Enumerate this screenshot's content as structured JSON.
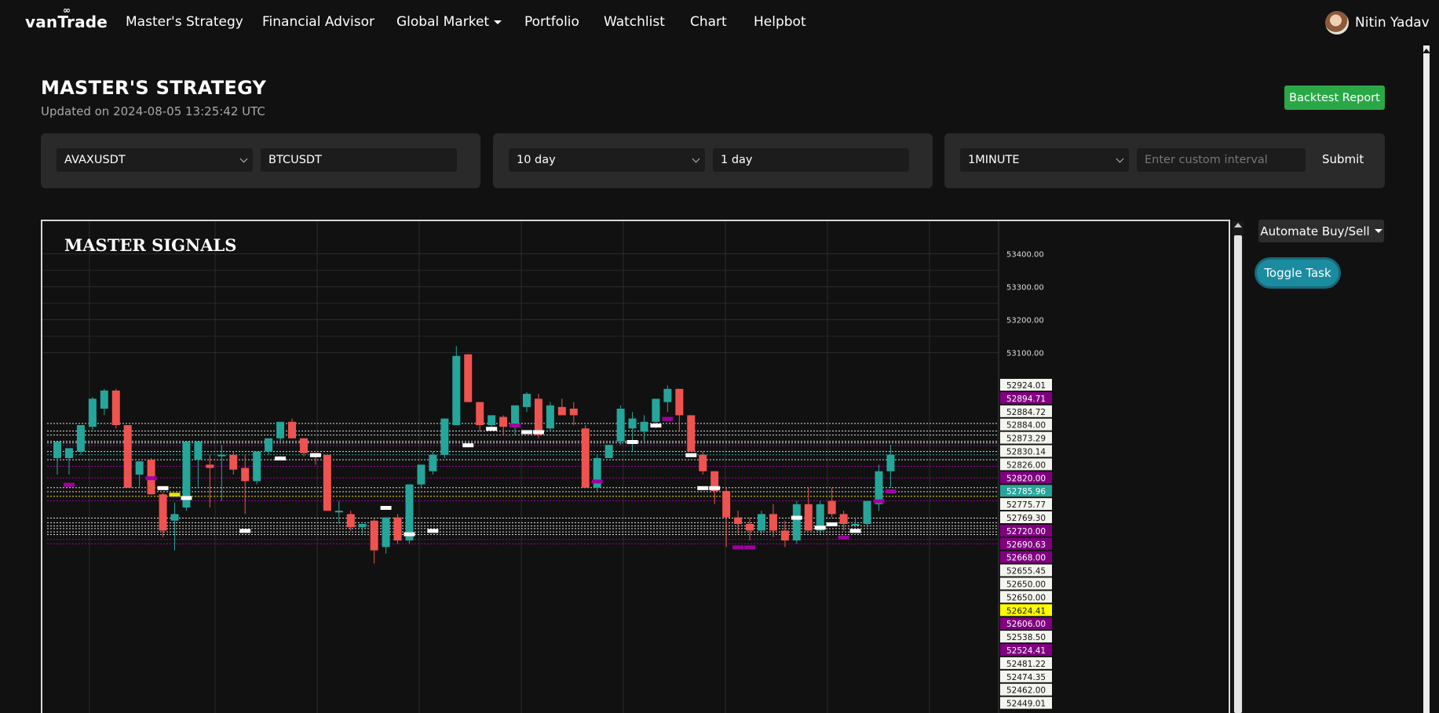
{
  "brand": {
    "logo_text": "vanTrade",
    "logo_mark": "∞"
  },
  "nav": {
    "items": [
      {
        "label": "Master's Strategy"
      },
      {
        "label": "Financial Advisor"
      },
      {
        "label": "Global Market"
      },
      {
        "label": "Portfolio"
      },
      {
        "label": "Watchlist"
      },
      {
        "label": "Chart"
      },
      {
        "label": "Helpbot"
      }
    ],
    "user_name": "Nitin Yadav"
  },
  "page": {
    "title": "MASTER'S STRATEGY",
    "updated": "Updated on 2024-08-05 13:25:42 UTC",
    "backtest_label": "Backtest Report"
  },
  "filters": {
    "symbol_select": "AVAXUSDT",
    "symbol_input": "BTCUSDT",
    "range_select": "10 day",
    "range_input": "1 day",
    "interval_select": "1MINUTE",
    "interval_placeholder": "Enter custom interval",
    "submit_label": "Submit"
  },
  "side": {
    "automate_label": "Automate Buy/Sell",
    "toggle_label": "Toggle Task"
  },
  "colors": {
    "up": "#26a69a",
    "down": "#ef5350",
    "purple": "#800080",
    "yellow": "#ffff00",
    "accent_green": "#2aa847",
    "toggle": "#1b8ca0"
  },
  "chart_data": {
    "type": "candlestick",
    "title": "MASTER SIGNALS",
    "ylim": [
      52440,
      53480
    ],
    "axis_ticks": [
      53400,
      53300,
      53200,
      53100
    ],
    "price_labels": [
      {
        "text": "52924.01",
        "value": 52924.01,
        "style": "white"
      },
      {
        "text": "52894.71",
        "value": 52894.71,
        "style": "purple"
      },
      {
        "text": "52884.72",
        "value": 52884.72,
        "style": "white"
      },
      {
        "text": "52884.00",
        "value": 52884.0,
        "style": "white"
      },
      {
        "text": "52873.29",
        "value": 52873.29,
        "style": "white"
      },
      {
        "text": "52830.14",
        "value": 52830.14,
        "style": "white"
      },
      {
        "text": "52826.00",
        "value": 52826.0,
        "style": "white"
      },
      {
        "text": "52820.00",
        "value": 52820.0,
        "style": "purple"
      },
      {
        "text": "52785.96",
        "value": 52785.96,
        "style": "teal"
      },
      {
        "text": "52775.77",
        "value": 52775.77,
        "style": "white"
      },
      {
        "text": "52769.30",
        "value": 52769.3,
        "style": "white"
      },
      {
        "text": "52720.00",
        "value": 52720.0,
        "style": "purple"
      },
      {
        "text": "52690.63",
        "value": 52690.63,
        "style": "purple"
      },
      {
        "text": "52668.00",
        "value": 52668.0,
        "style": "purple"
      },
      {
        "text": "52655.45",
        "value": 52655.45,
        "style": "white"
      },
      {
        "text": "52650.00",
        "value": 52650.0,
        "style": "white"
      },
      {
        "text": "52650.00",
        "value": 52650.0,
        "style": "white"
      },
      {
        "text": "52624.41",
        "value": 52624.41,
        "style": "yellow"
      },
      {
        "text": "52606.00",
        "value": 52606.0,
        "style": "purple"
      },
      {
        "text": "52538.50",
        "value": 52538.5,
        "style": "white"
      },
      {
        "text": "52524.41",
        "value": 52524.41,
        "style": "purple"
      },
      {
        "text": "52481.22",
        "value": 52481.22,
        "style": "white"
      },
      {
        "text": "52474.35",
        "value": 52474.35,
        "style": "white"
      },
      {
        "text": "52462.00",
        "value": 52462.0,
        "style": "white"
      },
      {
        "text": "52449.01",
        "value": 52449.01,
        "style": "white"
      }
    ],
    "level_lines": [
      {
        "value": 52885,
        "style": "white"
      },
      {
        "value": 52862,
        "style": "white"
      },
      {
        "value": 52850,
        "style": "white"
      },
      {
        "value": 52831,
        "style": "white"
      },
      {
        "value": 52826,
        "style": "white"
      },
      {
        "value": 52818,
        "style": "purple"
      },
      {
        "value": 52800,
        "style": "white"
      },
      {
        "value": 52790,
        "style": "teal"
      },
      {
        "value": 52775,
        "style": "white"
      },
      {
        "value": 52755,
        "style": "purple"
      },
      {
        "value": 52720,
        "style": "purple"
      },
      {
        "value": 52690,
        "style": "white"
      },
      {
        "value": 52678,
        "style": "white"
      },
      {
        "value": 52664,
        "style": "yellow"
      },
      {
        "value": 52650,
        "style": "purple"
      },
      {
        "value": 52598,
        "style": "white"
      },
      {
        "value": 52584,
        "style": "white"
      },
      {
        "value": 52574,
        "style": "white"
      },
      {
        "value": 52566,
        "style": "white"
      },
      {
        "value": 52556,
        "style": "white"
      },
      {
        "value": 52548,
        "style": "white"
      },
      {
        "value": 52533,
        "style": "purple"
      },
      {
        "value": 52520,
        "style": "purple"
      }
    ],
    "candles": [
      {
        "o": 52780,
        "h": 52830,
        "l": 52730,
        "c": 52830
      },
      {
        "o": 52780,
        "h": 52805,
        "l": 52730,
        "c": 52810
      },
      {
        "o": 52800,
        "h": 52880,
        "l": 52790,
        "c": 52880
      },
      {
        "o": 52875,
        "h": 52965,
        "l": 52865,
        "c": 52960
      },
      {
        "o": 52930,
        "h": 52990,
        "l": 52910,
        "c": 52985
      },
      {
        "o": 52985,
        "h": 52990,
        "l": 52870,
        "c": 52880
      },
      {
        "o": 52880,
        "h": 52880,
        "l": 52690,
        "c": 52690
      },
      {
        "o": 52730,
        "h": 52770,
        "l": 52690,
        "c": 52770
      },
      {
        "o": 52775,
        "h": 52780,
        "l": 52670,
        "c": 52670
      },
      {
        "o": 52670,
        "h": 52675,
        "l": 52540,
        "c": 52560
      },
      {
        "o": 52590,
        "h": 52645,
        "l": 52500,
        "c": 52610
      },
      {
        "o": 52630,
        "h": 52820,
        "l": 52620,
        "c": 52830
      },
      {
        "o": 52775,
        "h": 52830,
        "l": 52690,
        "c": 52830
      },
      {
        "o": 52760,
        "h": 52790,
        "l": 52630,
        "c": 52750
      },
      {
        "o": 52790,
        "h": 52820,
        "l": 52650,
        "c": 52790
      },
      {
        "o": 52790,
        "h": 52800,
        "l": 52730,
        "c": 52745
      },
      {
        "o": 52750,
        "h": 52790,
        "l": 52610,
        "c": 52710
      },
      {
        "o": 52710,
        "h": 52800,
        "l": 52700,
        "c": 52800
      },
      {
        "o": 52800,
        "h": 52840,
        "l": 52790,
        "c": 52840
      },
      {
        "o": 52840,
        "h": 52890,
        "l": 52830,
        "c": 52890
      },
      {
        "o": 52890,
        "h": 52900,
        "l": 52840,
        "c": 52840
      },
      {
        "o": 52840,
        "h": 52840,
        "l": 52785,
        "c": 52795
      },
      {
        "o": 52795,
        "h": 52790,
        "l": 52760,
        "c": 52790
      },
      {
        "o": 52790,
        "h": 52790,
        "l": 52620,
        "c": 52620
      },
      {
        "o": 52620,
        "h": 52650,
        "l": 52580,
        "c": 52620
      },
      {
        "o": 52610,
        "h": 52620,
        "l": 52560,
        "c": 52570
      },
      {
        "o": 52570,
        "h": 52580,
        "l": 52550,
        "c": 52580
      },
      {
        "o": 52590,
        "h": 52595,
        "l": 52460,
        "c": 52500
      },
      {
        "o": 52510,
        "h": 52600,
        "l": 52490,
        "c": 52600
      },
      {
        "o": 52600,
        "h": 52610,
        "l": 52520,
        "c": 52530
      },
      {
        "o": 52530,
        "h": 52700,
        "l": 52520,
        "c": 52700
      },
      {
        "o": 52700,
        "h": 52760,
        "l": 52690,
        "c": 52760
      },
      {
        "o": 52740,
        "h": 52800,
        "l": 52730,
        "c": 52790
      },
      {
        "o": 52790,
        "h": 52900,
        "l": 52780,
        "c": 52900
      },
      {
        "o": 52880,
        "h": 53120,
        "l": 52880,
        "c": 53090
      },
      {
        "o": 53095,
        "h": 53095,
        "l": 52950,
        "c": 52950
      },
      {
        "o": 52950,
        "h": 52950,
        "l": 52860,
        "c": 52880
      },
      {
        "o": 52880,
        "h": 52910,
        "l": 52870,
        "c": 52910
      },
      {
        "o": 52905,
        "h": 52910,
        "l": 52850,
        "c": 52875
      },
      {
        "o": 52880,
        "h": 52940,
        "l": 52850,
        "c": 52940
      },
      {
        "o": 52935,
        "h": 52980,
        "l": 52920,
        "c": 52975
      },
      {
        "o": 52960,
        "h": 52975,
        "l": 52840,
        "c": 52850
      },
      {
        "o": 52870,
        "h": 52950,
        "l": 52860,
        "c": 52940
      },
      {
        "o": 52935,
        "h": 52960,
        "l": 52915,
        "c": 52910
      },
      {
        "o": 52930,
        "h": 52950,
        "l": 52880,
        "c": 52910
      },
      {
        "o": 52870,
        "h": 52880,
        "l": 52700,
        "c": 52690
      },
      {
        "o": 52690,
        "h": 52790,
        "l": 52680,
        "c": 52780
      },
      {
        "o": 52780,
        "h": 52820,
        "l": 52780,
        "c": 52820
      },
      {
        "o": 52830,
        "h": 52940,
        "l": 52820,
        "c": 52930
      },
      {
        "o": 52870,
        "h": 52920,
        "l": 52800,
        "c": 52900
      },
      {
        "o": 52860,
        "h": 52910,
        "l": 52830,
        "c": 52890
      },
      {
        "o": 52890,
        "h": 52950,
        "l": 52870,
        "c": 52960
      },
      {
        "o": 52950,
        "h": 53000,
        "l": 52920,
        "c": 52990
      },
      {
        "o": 52990,
        "h": 52990,
        "l": 52860,
        "c": 52910
      },
      {
        "o": 52910,
        "h": 52890,
        "l": 52800,
        "c": 52800
      },
      {
        "o": 52790,
        "h": 52800,
        "l": 52730,
        "c": 52740
      },
      {
        "o": 52740,
        "h": 52740,
        "l": 52640,
        "c": 52680
      },
      {
        "o": 52680,
        "h": 52690,
        "l": 52510,
        "c": 52600
      },
      {
        "o": 52600,
        "h": 52620,
        "l": 52550,
        "c": 52580
      },
      {
        "o": 52580,
        "h": 52600,
        "l": 52530,
        "c": 52560
      },
      {
        "o": 52560,
        "h": 52620,
        "l": 52550,
        "c": 52610
      },
      {
        "o": 52610,
        "h": 52640,
        "l": 52540,
        "c": 52560
      },
      {
        "o": 52560,
        "h": 52590,
        "l": 52510,
        "c": 52530
      },
      {
        "o": 52530,
        "h": 52650,
        "l": 52520,
        "c": 52640
      },
      {
        "o": 52640,
        "h": 52690,
        "l": 52560,
        "c": 52560
      },
      {
        "o": 52560,
        "h": 52650,
        "l": 52550,
        "c": 52640
      },
      {
        "o": 52650,
        "h": 52690,
        "l": 52600,
        "c": 52610
      },
      {
        "o": 52610,
        "h": 52620,
        "l": 52560,
        "c": 52580
      },
      {
        "o": 52580,
        "h": 52600,
        "l": 52570,
        "c": 52580
      },
      {
        "o": 52580,
        "h": 52650,
        "l": 52570,
        "c": 52650
      },
      {
        "o": 52640,
        "h": 52760,
        "l": 52620,
        "c": 52740
      },
      {
        "o": 52740,
        "h": 52820,
        "l": 52690,
        "c": 52790
      }
    ]
  }
}
